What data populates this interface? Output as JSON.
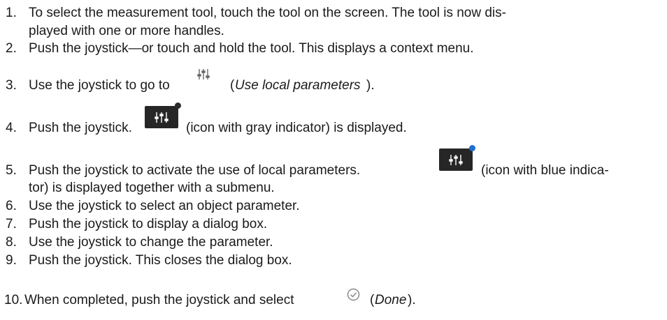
{
  "steps": [
    {
      "n": "1.",
      "text": "To select the measurement tool, touch the tool on the screen. The tool is now dis-",
      "cont": "played with one or more handles."
    },
    {
      "n": "2.",
      "text": "Push the joystick—or touch and hold the tool. This displays a context menu."
    },
    {
      "n": "3.",
      "pre": "Use the joystick to go to",
      "paren_open": "(",
      "italic": "Use local parameters",
      "paren_close": ")."
    },
    {
      "n": "4.",
      "pre": "Push the joystick.",
      "post": "(icon with gray indicator) is displayed."
    },
    {
      "n": "5.",
      "pre": "Push the joystick to activate the use of local parameters.",
      "post": "(icon with blue indica-",
      "cont": "tor) is displayed together with a submenu."
    },
    {
      "n": "6.",
      "text": "Use the joystick to select an object parameter."
    },
    {
      "n": "7.",
      "text": "Push the joystick to display a dialog box."
    },
    {
      "n": "8.",
      "text": "Use the joystick to change the parameter."
    },
    {
      "n": "9.",
      "text": "Push the joystick. This closes the dialog box."
    },
    {
      "n": "10.",
      "pre": "When completed, push the joystick and select",
      "paren_open": "(",
      "italic": "Done",
      "paren_close": ")."
    }
  ],
  "icons": {
    "local_params": "sliders-icon",
    "gray_indicator_color": "#2b2b2b",
    "blue_indicator_color": "#1f6fd1",
    "done": "check-circle-icon"
  }
}
